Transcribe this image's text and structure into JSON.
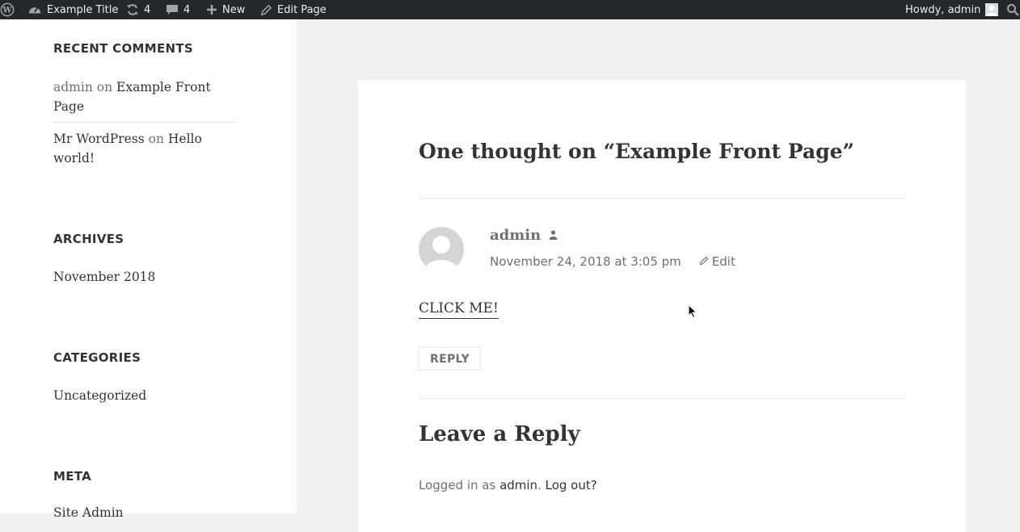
{
  "adminbar": {
    "site_title": "Example Title",
    "updates_count": "4",
    "comments_count": "4",
    "new_label": "New",
    "edit_page_label": "Edit Page",
    "howdy_label": "Howdy, admin"
  },
  "sidebar": {
    "recent_comments": {
      "title": "RECENT COMMENTS",
      "items": [
        {
          "author": "admin",
          "on": "on",
          "post_line1": "Example Front",
          "post_line2": "Page"
        },
        {
          "author": "Mr WordPress",
          "on": "on",
          "post_line1": "Hello",
          "post_line2": "world!"
        }
      ]
    },
    "archives": {
      "title": "ARCHIVES",
      "items": [
        "November 2018"
      ]
    },
    "categories": {
      "title": "CATEGORIES",
      "items": [
        "Uncategorized"
      ]
    },
    "meta": {
      "title": "META",
      "items": [
        "Site Admin"
      ]
    }
  },
  "main": {
    "comments_title": "One thought on “Example Front Page”",
    "comment": {
      "author": "admin",
      "date": "November 24, 2018 at 3:05 pm",
      "edit_label": "Edit",
      "content_link": "CLICK ME!",
      "reply_label": "REPLY"
    },
    "reply_title": "Leave a Reply",
    "logged_in": {
      "prefix": "Logged in as",
      "user": "admin",
      "separator": ".",
      "logout": "Log out?"
    }
  },
  "colors": {
    "adminbar_bg": "#23282d",
    "page_bg": "#f1f1f1",
    "text": "#333333",
    "muted": "#707070"
  }
}
